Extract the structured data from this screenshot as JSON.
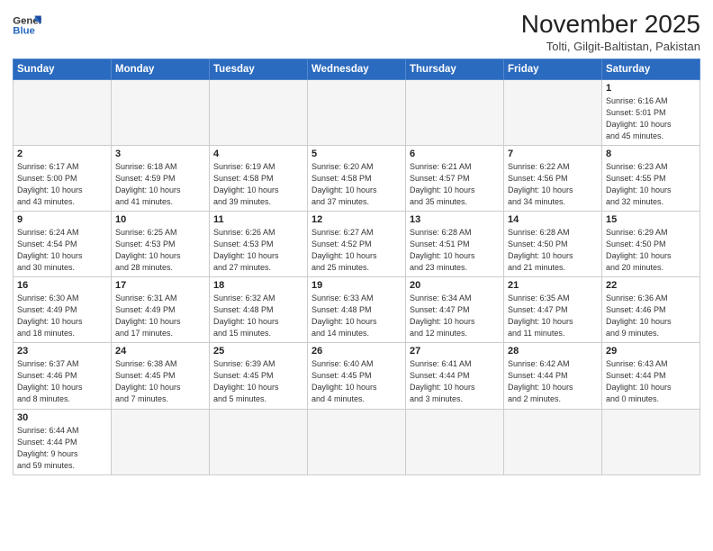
{
  "header": {
    "logo_general": "General",
    "logo_blue": "Blue",
    "month_title": "November 2025",
    "location": "Tolti, Gilgit-Baltistan, Pakistan"
  },
  "weekdays": [
    "Sunday",
    "Monday",
    "Tuesday",
    "Wednesday",
    "Thursday",
    "Friday",
    "Saturday"
  ],
  "weeks": [
    [
      {
        "day": "",
        "info": "",
        "empty": true
      },
      {
        "day": "",
        "info": "",
        "empty": true
      },
      {
        "day": "",
        "info": "",
        "empty": true
      },
      {
        "day": "",
        "info": "",
        "empty": true
      },
      {
        "day": "",
        "info": "",
        "empty": true
      },
      {
        "day": "",
        "info": "",
        "empty": true
      },
      {
        "day": "1",
        "info": "Sunrise: 6:16 AM\nSunset: 5:01 PM\nDaylight: 10 hours\nand 45 minutes.",
        "empty": false
      }
    ],
    [
      {
        "day": "2",
        "info": "Sunrise: 6:17 AM\nSunset: 5:00 PM\nDaylight: 10 hours\nand 43 minutes.",
        "empty": false
      },
      {
        "day": "3",
        "info": "Sunrise: 6:18 AM\nSunset: 4:59 PM\nDaylight: 10 hours\nand 41 minutes.",
        "empty": false
      },
      {
        "day": "4",
        "info": "Sunrise: 6:19 AM\nSunset: 4:58 PM\nDaylight: 10 hours\nand 39 minutes.",
        "empty": false
      },
      {
        "day": "5",
        "info": "Sunrise: 6:20 AM\nSunset: 4:58 PM\nDaylight: 10 hours\nand 37 minutes.",
        "empty": false
      },
      {
        "day": "6",
        "info": "Sunrise: 6:21 AM\nSunset: 4:57 PM\nDaylight: 10 hours\nand 35 minutes.",
        "empty": false
      },
      {
        "day": "7",
        "info": "Sunrise: 6:22 AM\nSunset: 4:56 PM\nDaylight: 10 hours\nand 34 minutes.",
        "empty": false
      },
      {
        "day": "8",
        "info": "Sunrise: 6:23 AM\nSunset: 4:55 PM\nDaylight: 10 hours\nand 32 minutes.",
        "empty": false
      }
    ],
    [
      {
        "day": "9",
        "info": "Sunrise: 6:24 AM\nSunset: 4:54 PM\nDaylight: 10 hours\nand 30 minutes.",
        "empty": false
      },
      {
        "day": "10",
        "info": "Sunrise: 6:25 AM\nSunset: 4:53 PM\nDaylight: 10 hours\nand 28 minutes.",
        "empty": false
      },
      {
        "day": "11",
        "info": "Sunrise: 6:26 AM\nSunset: 4:53 PM\nDaylight: 10 hours\nand 27 minutes.",
        "empty": false
      },
      {
        "day": "12",
        "info": "Sunrise: 6:27 AM\nSunset: 4:52 PM\nDaylight: 10 hours\nand 25 minutes.",
        "empty": false
      },
      {
        "day": "13",
        "info": "Sunrise: 6:28 AM\nSunset: 4:51 PM\nDaylight: 10 hours\nand 23 minutes.",
        "empty": false
      },
      {
        "day": "14",
        "info": "Sunrise: 6:28 AM\nSunset: 4:50 PM\nDaylight: 10 hours\nand 21 minutes.",
        "empty": false
      },
      {
        "day": "15",
        "info": "Sunrise: 6:29 AM\nSunset: 4:50 PM\nDaylight: 10 hours\nand 20 minutes.",
        "empty": false
      }
    ],
    [
      {
        "day": "16",
        "info": "Sunrise: 6:30 AM\nSunset: 4:49 PM\nDaylight: 10 hours\nand 18 minutes.",
        "empty": false
      },
      {
        "day": "17",
        "info": "Sunrise: 6:31 AM\nSunset: 4:49 PM\nDaylight: 10 hours\nand 17 minutes.",
        "empty": false
      },
      {
        "day": "18",
        "info": "Sunrise: 6:32 AM\nSunset: 4:48 PM\nDaylight: 10 hours\nand 15 minutes.",
        "empty": false
      },
      {
        "day": "19",
        "info": "Sunrise: 6:33 AM\nSunset: 4:48 PM\nDaylight: 10 hours\nand 14 minutes.",
        "empty": false
      },
      {
        "day": "20",
        "info": "Sunrise: 6:34 AM\nSunset: 4:47 PM\nDaylight: 10 hours\nand 12 minutes.",
        "empty": false
      },
      {
        "day": "21",
        "info": "Sunrise: 6:35 AM\nSunset: 4:47 PM\nDaylight: 10 hours\nand 11 minutes.",
        "empty": false
      },
      {
        "day": "22",
        "info": "Sunrise: 6:36 AM\nSunset: 4:46 PM\nDaylight: 10 hours\nand 9 minutes.",
        "empty": false
      }
    ],
    [
      {
        "day": "23",
        "info": "Sunrise: 6:37 AM\nSunset: 4:46 PM\nDaylight: 10 hours\nand 8 minutes.",
        "empty": false
      },
      {
        "day": "24",
        "info": "Sunrise: 6:38 AM\nSunset: 4:45 PM\nDaylight: 10 hours\nand 7 minutes.",
        "empty": false
      },
      {
        "day": "25",
        "info": "Sunrise: 6:39 AM\nSunset: 4:45 PM\nDaylight: 10 hours\nand 5 minutes.",
        "empty": false
      },
      {
        "day": "26",
        "info": "Sunrise: 6:40 AM\nSunset: 4:45 PM\nDaylight: 10 hours\nand 4 minutes.",
        "empty": false
      },
      {
        "day": "27",
        "info": "Sunrise: 6:41 AM\nSunset: 4:44 PM\nDaylight: 10 hours\nand 3 minutes.",
        "empty": false
      },
      {
        "day": "28",
        "info": "Sunrise: 6:42 AM\nSunset: 4:44 PM\nDaylight: 10 hours\nand 2 minutes.",
        "empty": false
      },
      {
        "day": "29",
        "info": "Sunrise: 6:43 AM\nSunset: 4:44 PM\nDaylight: 10 hours\nand 0 minutes.",
        "empty": false
      }
    ],
    [
      {
        "day": "30",
        "info": "Sunrise: 6:44 AM\nSunset: 4:44 PM\nDaylight: 9 hours\nand 59 minutes.",
        "empty": false,
        "last": true
      },
      {
        "day": "",
        "info": "",
        "empty": true,
        "last": true
      },
      {
        "day": "",
        "info": "",
        "empty": true,
        "last": true
      },
      {
        "day": "",
        "info": "",
        "empty": true,
        "last": true
      },
      {
        "day": "",
        "info": "",
        "empty": true,
        "last": true
      },
      {
        "day": "",
        "info": "",
        "empty": true,
        "last": true
      },
      {
        "day": "",
        "info": "",
        "empty": true,
        "last": true
      }
    ]
  ]
}
